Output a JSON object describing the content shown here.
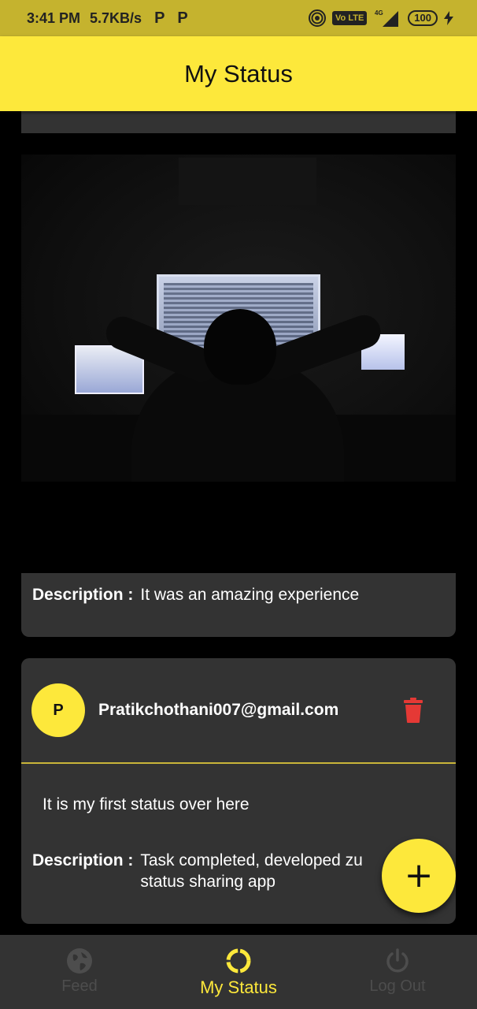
{
  "status_bar": {
    "time": "3:41 PM",
    "speed": "5.7KB/s",
    "app_badges": [
      "P",
      "P"
    ],
    "network_type": "4G",
    "volte": "Vo LTE",
    "battery": "100"
  },
  "app_bar": {
    "title": "My Status"
  },
  "posts": [
    {
      "image_icon": "photo-of-person-at-computer",
      "description_label": "Description :",
      "description": "It was an amazing experience"
    },
    {
      "avatar_letter": "P",
      "email": "Pratikchothani007@gmail.com",
      "status_text": "It is my first status over here",
      "description_label": "Description :",
      "description": "Task completed, developed zu status sharing app"
    }
  ],
  "fab": {
    "icon": "plus-icon"
  },
  "bottom_nav": [
    {
      "label": "Feed",
      "icon": "globe-icon",
      "active": false
    },
    {
      "label": "My Status",
      "icon": "circle-loader-icon",
      "active": true
    },
    {
      "label": "Log Out",
      "icon": "power-icon",
      "active": false
    }
  ],
  "colors": {
    "accent": "#fde83b",
    "status_bar": "#c5b32e",
    "card": "#333333",
    "background": "#000000",
    "delete": "#e53935"
  }
}
